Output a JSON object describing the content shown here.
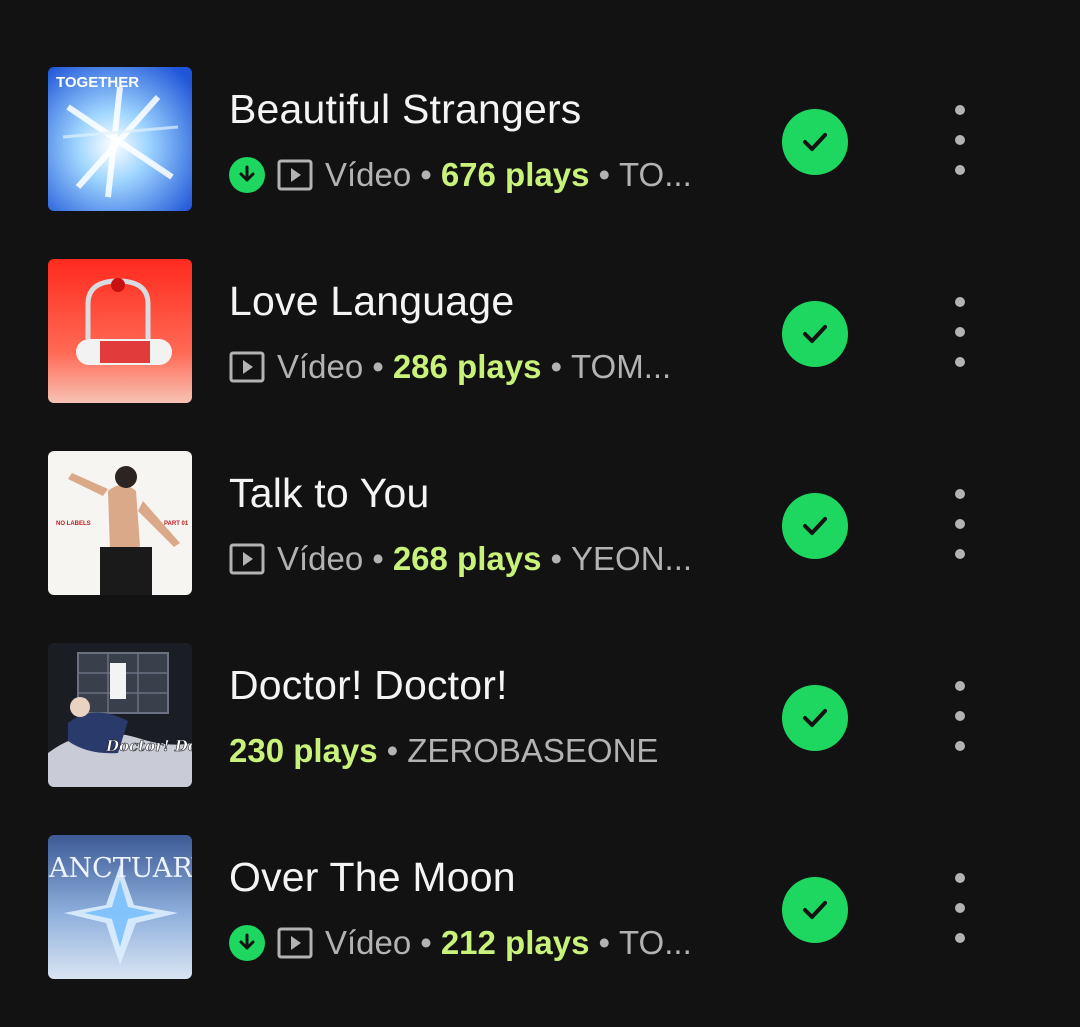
{
  "colors": {
    "background": "#121212",
    "accent_green": "#1ed760",
    "plays_highlight": "#c8f27a",
    "secondary_text": "#b3b3b3"
  },
  "tracks": [
    {
      "title": "Beautiful Strangers",
      "downloaded": true,
      "type": "Vídeo",
      "plays": "676 plays",
      "artist": "TO...",
      "cover_text": "TOGETHER",
      "cover_icon": "album-cover-together"
    },
    {
      "title": "Love Language",
      "downloaded": false,
      "type": "Vídeo",
      "plays": "286 plays",
      "artist": "TOM...",
      "cover_icon": "album-cover-love-language"
    },
    {
      "title": "Talk to You",
      "downloaded": false,
      "type": "Vídeo",
      "plays": "268 plays",
      "artist": "YEON...",
      "cover_text_left": "NO LABELS",
      "cover_text_right": "PART 01",
      "cover_icon": "album-cover-no-labels"
    },
    {
      "title": "Doctor! Doctor!",
      "downloaded": false,
      "type": "",
      "plays": "230 plays",
      "artist": "ZEROBASEONE",
      "cover_text": "Doctor! Doctor",
      "cover_icon": "album-cover-doctor-doctor"
    },
    {
      "title": "Over The Moon",
      "downloaded": true,
      "type": "Vídeo",
      "plays": "212 plays",
      "artist": "TO...",
      "cover_text": "SANCTUARY",
      "cover_icon": "album-cover-sanctuary"
    }
  ],
  "icons": {
    "download": "download-icon",
    "video": "video-icon",
    "added": "check-circle-icon",
    "more": "more-options-icon"
  }
}
